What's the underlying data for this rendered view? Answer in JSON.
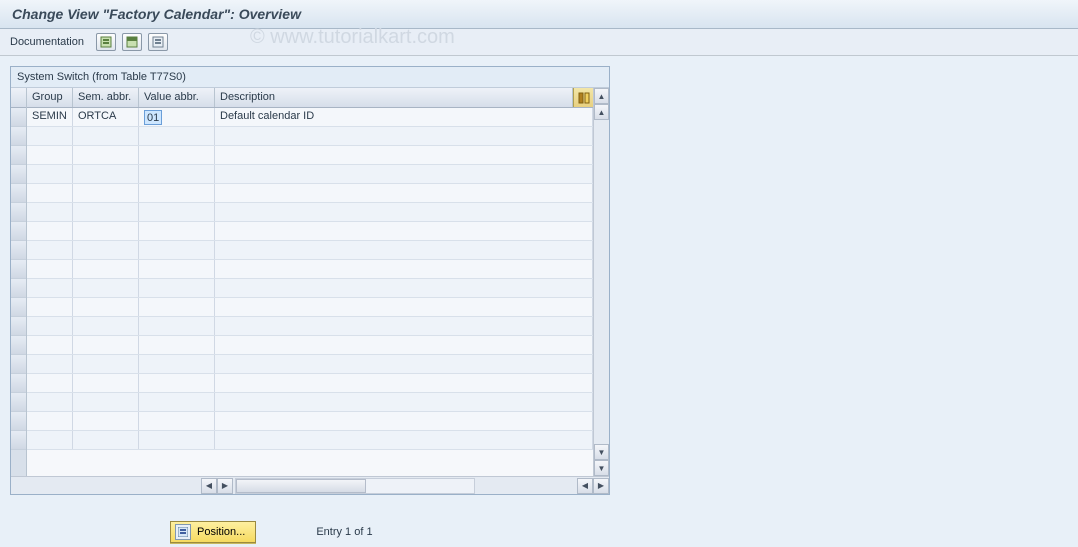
{
  "header": {
    "title": "Change View \"Factory Calendar\": Overview"
  },
  "toolbar": {
    "documentation_label": "Documentation"
  },
  "watermark": "© www.tutorialkart.com",
  "table": {
    "title": "System Switch (from Table T77S0)",
    "columns": {
      "group": "Group",
      "sem": "Sem. abbr.",
      "val": "Value abbr.",
      "desc": "Description"
    },
    "rows": [
      {
        "group": "SEMIN",
        "sem": "ORTCA",
        "val": "01",
        "desc": "Default calendar ID"
      }
    ]
  },
  "footer": {
    "position_label": "Position...",
    "entry_text": "Entry 1 of 1"
  }
}
